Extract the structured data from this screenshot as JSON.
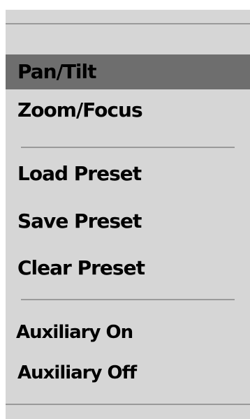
{
  "menu": {
    "selected_color": "#6e6e6e",
    "background_color": "#d6d6d6",
    "items": [
      {
        "label": "Pan/Tilt",
        "selected": true
      },
      {
        "label": "Zoom/Focus",
        "selected": false
      },
      {
        "label": "Load Preset",
        "selected": false
      },
      {
        "label": "Save Preset",
        "selected": false
      },
      {
        "label": "Clear Preset",
        "selected": false
      },
      {
        "label": "Auxiliary On",
        "selected": false
      },
      {
        "label": "Auxiliary Off",
        "selected": false
      }
    ]
  }
}
